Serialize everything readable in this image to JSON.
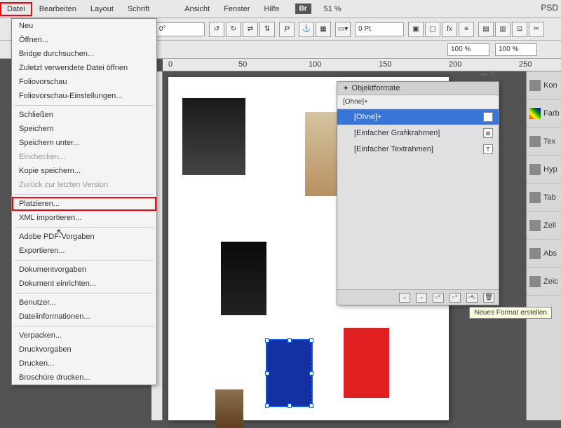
{
  "menubar": {
    "items": [
      "Datei",
      "Bearbeiten",
      "Layout",
      "Schrift",
      "Ansicht",
      "Fenster",
      "Hilfe"
    ],
    "br_label": "Br",
    "zoom": "51 %",
    "psd": "PSD"
  },
  "toolbar2": {
    "angle1": "0°",
    "angle2": "0°",
    "pt": "0 Pt",
    "p_label": "P"
  },
  "toolbar3": {
    "pct1": "100 %",
    "pct2": "100 %"
  },
  "ruler": {
    "t0": "0",
    "t1": "50",
    "t2": "100",
    "t3": "150",
    "t4": "200",
    "t5": "250"
  },
  "fileMenu": {
    "items": [
      {
        "label": "Neu",
        "type": "item"
      },
      {
        "label": "Öffnen...",
        "type": "item"
      },
      {
        "label": "Bridge durchsuchen...",
        "type": "item"
      },
      {
        "label": "Zuletzt verwendete Datei öffnen",
        "type": "item"
      },
      {
        "label": "Foliovorschau",
        "type": "item"
      },
      {
        "label": "Foliovorschau-Einstellungen...",
        "type": "item"
      },
      {
        "type": "sep"
      },
      {
        "label": "Schließen",
        "type": "item"
      },
      {
        "label": "Speichern",
        "type": "item"
      },
      {
        "label": "Speichern unter...",
        "type": "item"
      },
      {
        "label": "Einchecken...",
        "type": "disabled"
      },
      {
        "label": "Kopie speichern...",
        "type": "item"
      },
      {
        "label": "Zurück zur letzten Version",
        "type": "disabled"
      },
      {
        "type": "sep"
      },
      {
        "label": "Platzieren...",
        "type": "sel"
      },
      {
        "label": "XML importieren...",
        "type": "item"
      },
      {
        "type": "sep"
      },
      {
        "label": "Adobe PDF-Vorgaben",
        "type": "item"
      },
      {
        "label": "Exportieren...",
        "type": "item"
      },
      {
        "type": "sep"
      },
      {
        "label": "Dokumentvorgaben",
        "type": "item"
      },
      {
        "label": "Dokument einrichten...",
        "type": "item"
      },
      {
        "type": "sep"
      },
      {
        "label": "Benutzer...",
        "type": "item"
      },
      {
        "label": "Dateiinformationen...",
        "type": "item"
      },
      {
        "type": "sep"
      },
      {
        "label": "Verpacken...",
        "type": "item"
      },
      {
        "label": "Druckvorgaben",
        "type": "item"
      },
      {
        "label": "Drucken...",
        "type": "item"
      },
      {
        "label": "Broschüre drucken...",
        "type": "item"
      }
    ]
  },
  "panel": {
    "title": "Objektformate",
    "header": "[Ohne]+",
    "rows": [
      {
        "label": "[Ohne]+",
        "active": true,
        "icon": "⊘"
      },
      {
        "label": "[Einfacher Grafikrahmen]",
        "active": false,
        "icon": "⊞"
      },
      {
        "label": "[Einfacher Textrahmen]",
        "active": false,
        "icon": "T"
      }
    ]
  },
  "tooltip": "Neues Format erstellen",
  "sidepanels": {
    "items": [
      "Kon",
      "Farb",
      "Tex",
      "Hyp",
      "Tab",
      "Zell",
      "Abs",
      "Zeic"
    ]
  }
}
